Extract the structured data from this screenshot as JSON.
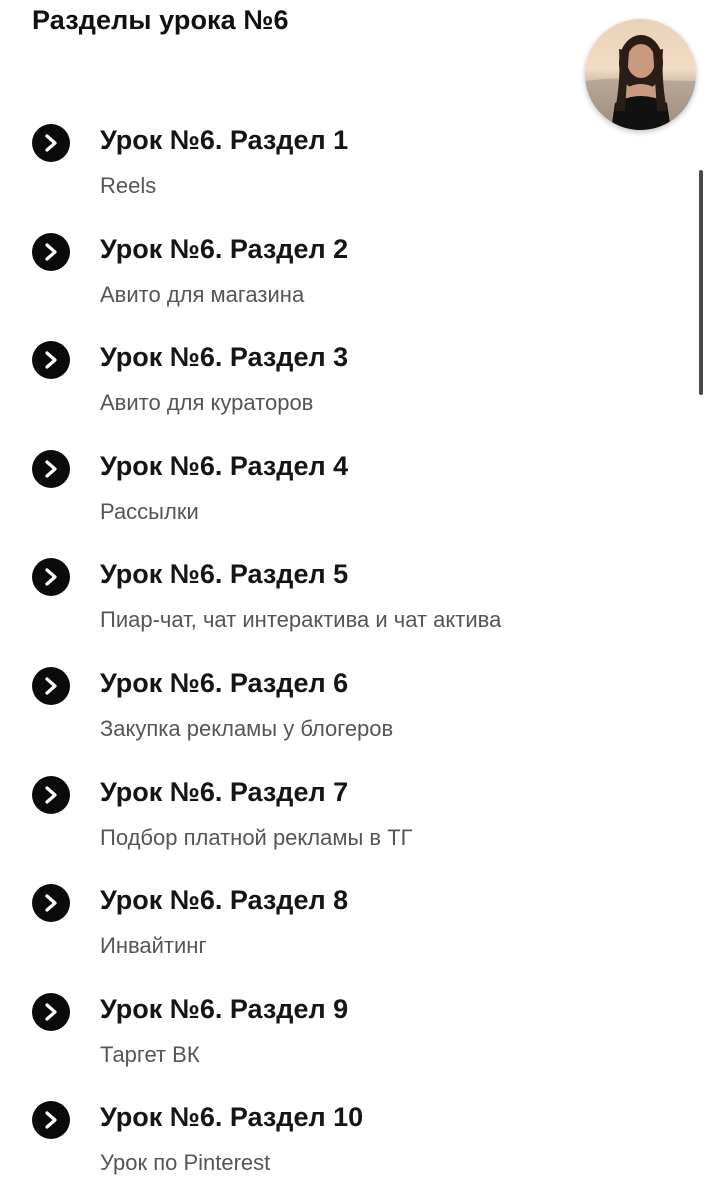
{
  "header": {
    "title": "Разделы урока №6"
  },
  "icons": {
    "item_arrow": "chevron-right-icon"
  },
  "colors": {
    "icon_background": "#0b0b0b",
    "title_text": "#151515",
    "subtitle_text": "#555555"
  },
  "sections": [
    {
      "title": "Урок №6. Раздел 1",
      "subtitle": "Reels"
    },
    {
      "title": "Урок №6. Раздел 2",
      "subtitle": "Авито для магазина"
    },
    {
      "title": "Урок №6. Раздел 3",
      "subtitle": "Авито для кураторов"
    },
    {
      "title": "Урок №6. Раздел 4",
      "subtitle": "Рассылки"
    },
    {
      "title": "Урок №6. Раздел 5",
      "subtitle": "Пиар-чат, чат интерактива и чат актива"
    },
    {
      "title": "Урок №6. Раздел 6",
      "subtitle": "Закупка рекламы у блогеров"
    },
    {
      "title": "Урок №6. Раздел 7",
      "subtitle": "Подбор платной рекламы в ТГ"
    },
    {
      "title": "Урок №6. Раздел 8",
      "subtitle": "Инвайтинг"
    },
    {
      "title": "Урок №6. Раздел 9",
      "subtitle": "Таргет ВК"
    },
    {
      "title": "Урок №6. Раздел 10",
      "subtitle": "Урок по Pinterest"
    }
  ]
}
